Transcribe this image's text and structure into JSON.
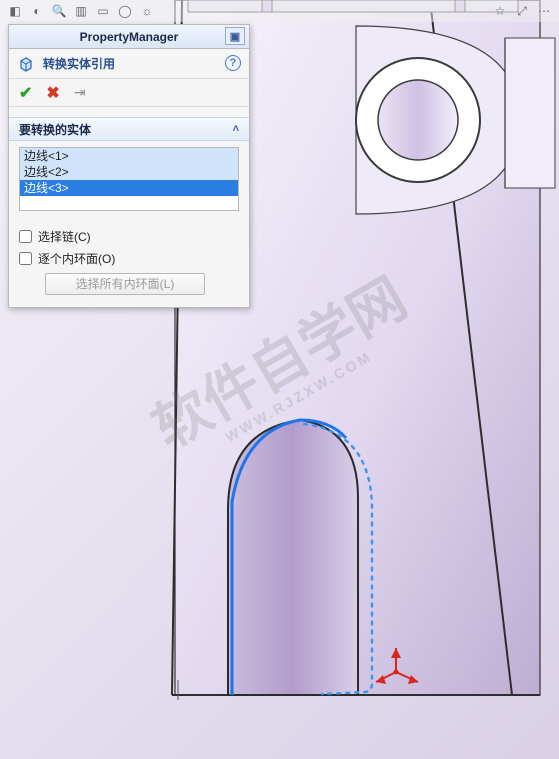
{
  "panel": {
    "header": "PropertyManager",
    "feature_title": "转换实体引用",
    "section_title": "要转换的实体",
    "list_items": [
      "边线<1>",
      "边线<2>",
      "边线<3>"
    ],
    "selected_index": 2,
    "opt_chain": "选择链(C)",
    "opt_inner": "逐个内环面(O)",
    "btn_inner_all": "选择所有内环面(L)"
  },
  "watermark": {
    "main": "软件自学网",
    "sub": "WWW.RJZXW.COM"
  }
}
